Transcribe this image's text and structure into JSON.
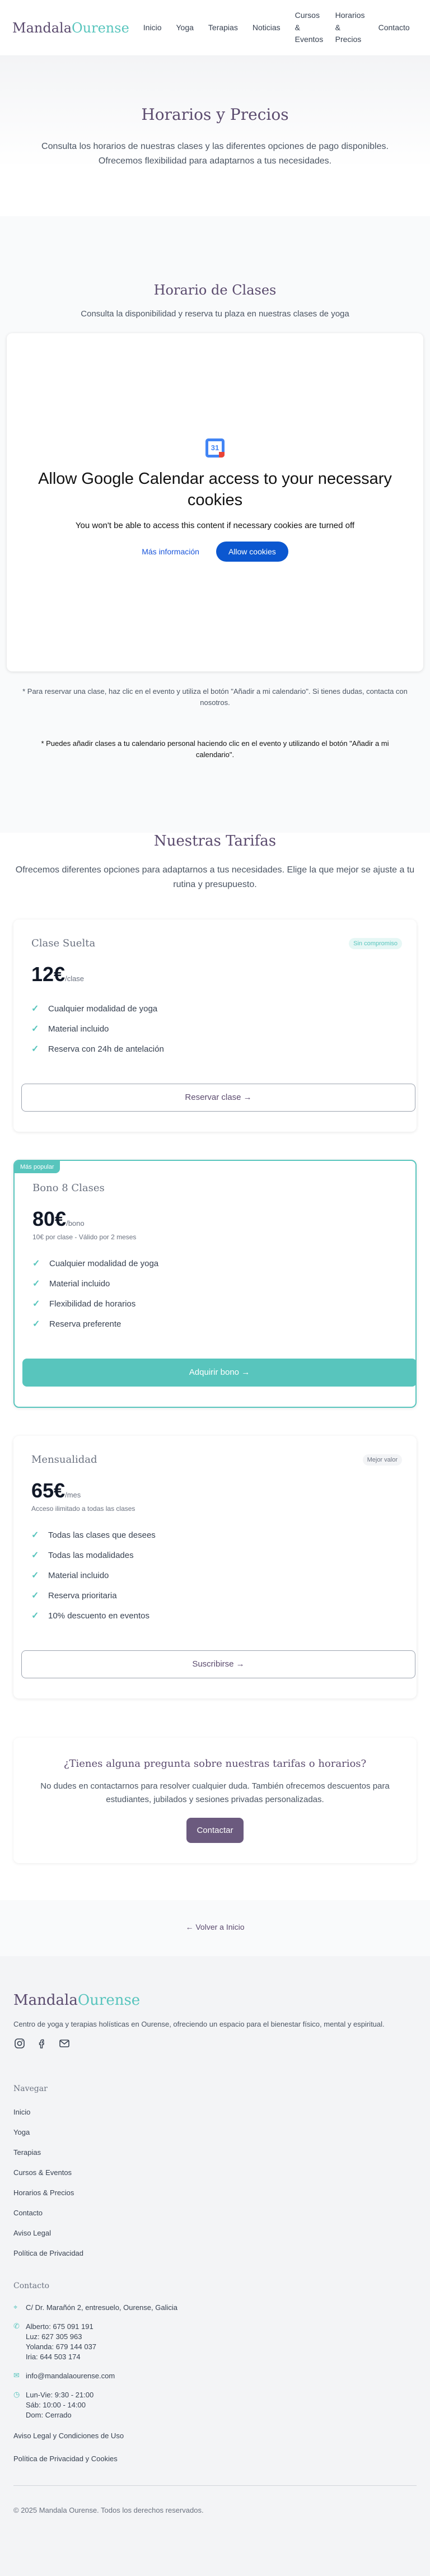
{
  "header": {
    "logo_main": "Mandala",
    "logo_accent": "Ourense",
    "nav": [
      {
        "label": "Inicio",
        "name": "nav-inicio"
      },
      {
        "label": "Yoga",
        "name": "nav-yoga"
      },
      {
        "label": "Terapias",
        "name": "nav-terapias"
      },
      {
        "label": "Noticias",
        "name": "nav-noticias"
      },
      {
        "label": "Cursos & Eventos",
        "name": "nav-cursos-eventos"
      },
      {
        "label": "Horarios & Precios",
        "name": "nav-horarios-precios"
      },
      {
        "label": "Contacto",
        "name": "nav-contacto"
      }
    ]
  },
  "hero": {
    "title": "Horarios y Precios",
    "text": "Consulta los horarios de nuestras clases y las diferentes opciones de pago disponibles. Ofrecemos flexibilidad para adaptarnos a tus necesidades."
  },
  "schedule": {
    "title": "Horario de Clases",
    "subtitle": "Consulta la disponibilidad y reserva tu plaza en nuestras clases de yoga",
    "calendar": {
      "icon_text": "31",
      "heading": "Allow Google Calendar access to your necessary cookies",
      "note": "You won't be able to access this content if necessary cookies are turned off",
      "more_label": "Más información",
      "allow_label": "Allow cookies"
    },
    "hint1": "* Para reservar una clase, haz clic en el evento y utiliza el botón \"Añadir a mi calendario\". Si tienes dudas, contacta con nosotros.",
    "hint2": "* Puedes añadir clases a tu calendario personal haciendo clic en el evento y utilizando el botón \"Añadir a mi calendario\"."
  },
  "pricing": {
    "title": "Nuestras Tarifas",
    "lead": "Ofrecemos diferentes opciones para adaptarnos a tus necesidades. Elige la que mejor se ajuste a tu rutina y presupuesto.",
    "plans": [
      {
        "title": "Clase Suelta",
        "tag": "Sin compromiso",
        "amount": "12€",
        "unit": "/clase",
        "note": "",
        "features": [
          "Cualquier modalidad de yoga",
          "Material incluido",
          "Reserva con 24h de antelación"
        ],
        "button": "Reservar clase →"
      },
      {
        "title": "Bono 8 Clases",
        "tag": "Más popular",
        "amount": "80€",
        "unit": "/bono",
        "note": "10€ por clase - Válido por 2 meses",
        "features": [
          "Cualquier modalidad de yoga",
          "Material incluido",
          "Flexibilidad de horarios",
          "Reserva preferente"
        ],
        "button": "Adquirir bono →"
      },
      {
        "title": "Mensualidad",
        "tag": "Mejor valor",
        "amount": "65€",
        "unit": "/mes",
        "note": "Acceso ilimitado a todas las clases",
        "features": [
          "Todas las clases que desees",
          "Todas las modalidades",
          "Material incluido",
          "Reserva prioritaria",
          "10% descuento en eventos"
        ],
        "button": "Suscribirse →"
      }
    ],
    "question": {
      "title": "¿Tienes alguna pregunta sobre nuestras tarifas o horarios?",
      "text": "No dudes en contactarnos para resolver cualquier duda. También ofrecemos descuentos para estudiantes, jubilados y sesiones privadas personalizadas.",
      "button": "Contactar"
    }
  },
  "back": {
    "label": "← Volver a Inicio"
  },
  "footer": {
    "logo_main": "Mandala",
    "logo_accent": "Ourense",
    "tagline": "Centro de yoga y terapias holísticas en Ourense, ofreciendo un espacio para el bienestar físico, mental y espiritual.",
    "nav_title": "Navegar",
    "nav_links": [
      "Inicio",
      "Yoga",
      "Terapias",
      "Cursos & Eventos",
      "Horarios & Precios",
      "Contacto",
      "Aviso Legal",
      "Política de Privacidad"
    ],
    "contact_title": "Contacto",
    "address": "C/ Dr. Marañón 2, entresuelo, Ourense, Galicia",
    "phones": [
      "Alberto: 675 091 191",
      "Luz: 627 305 963",
      "Yolanda: 679 144 037",
      "Iria: 644 503 174"
    ],
    "email": "info@mandalaourense.com",
    "hours": [
      "Lun-Vie: 9:30 - 21:00",
      "Sáb: 10:00 - 14:00",
      "Dom: Cerrado"
    ],
    "legal": [
      "Aviso Legal y Condiciones de Uso",
      "Política de Privacidad y Cookies"
    ],
    "copyright": "© 2025 Mandala Ourense. Todos los derechos reservados."
  }
}
